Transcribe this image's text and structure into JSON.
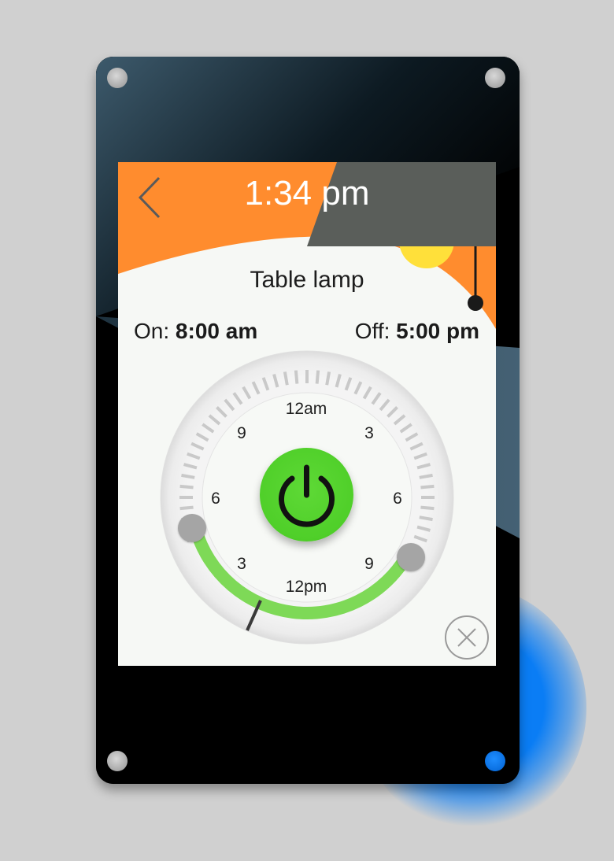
{
  "header": {
    "time": "1:34 pm"
  },
  "device": {
    "name": "Table lamp"
  },
  "schedule": {
    "on_label": "On:",
    "on_time": "8:00 am",
    "off_label": "Off:",
    "off_time": "5:00 pm"
  },
  "dial": {
    "hour_labels": {
      "top": "12am",
      "upper_left": "9",
      "upper_right": "3",
      "left": "6",
      "right": "6",
      "lower_left": "3",
      "lower_right": "9",
      "bottom": "12pm"
    },
    "active_color": "#7ed957",
    "accent_color": "#ff8c2e",
    "button_color": "#55d22f"
  },
  "icons": {
    "back": "chevron-left-icon",
    "power": "power-icon",
    "close": "close-circle-icon",
    "sun": "sun-icon"
  }
}
